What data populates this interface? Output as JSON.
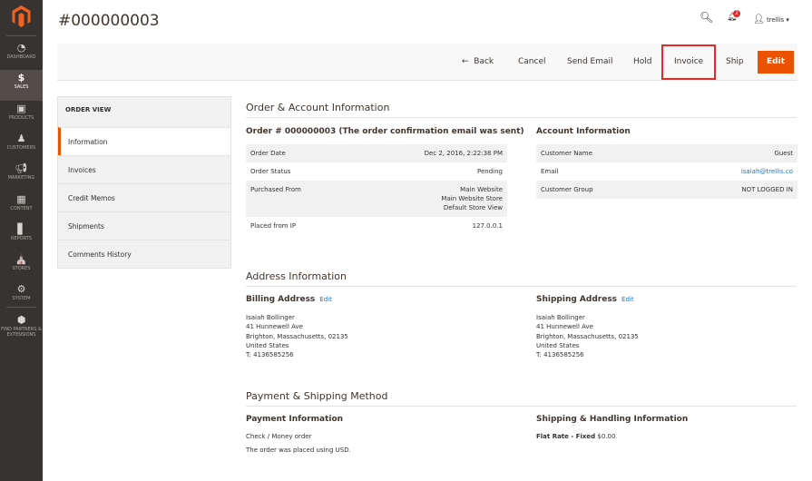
{
  "sidebar": {
    "items": [
      {
        "label": "DASHBOARD",
        "icon": "dashboard-icon"
      },
      {
        "label": "SALES",
        "icon": "dollar-icon",
        "active": true
      },
      {
        "label": "PRODUCTS",
        "icon": "box-icon"
      },
      {
        "label": "CUSTOMERS",
        "icon": "person-icon"
      },
      {
        "label": "MARKETING",
        "icon": "megaphone-icon"
      },
      {
        "label": "CONTENT",
        "icon": "layout-icon"
      },
      {
        "label": "REPORTS",
        "icon": "bar-chart-icon"
      },
      {
        "label": "STORES",
        "icon": "store-icon"
      },
      {
        "label": "SYSTEM",
        "icon": "gear-icon"
      },
      {
        "label": "FIND PARTNERS & EXTENSIONS",
        "icon": "cube-icon"
      }
    ]
  },
  "header": {
    "title": "#000000003",
    "notifications": "2",
    "user": "trellis"
  },
  "actions": {
    "back": "Back",
    "cancel": "Cancel",
    "send_email": "Send Email",
    "hold": "Hold",
    "invoice": "Invoice",
    "ship": "Ship",
    "edit": "Edit"
  },
  "nav": {
    "title": "ORDER VIEW",
    "items": [
      "Information",
      "Invoices",
      "Credit Memos",
      "Shipments",
      "Comments History"
    ]
  },
  "order": {
    "section": "Order & Account Information",
    "title": "Order # 000000003 (The order confirmation email was sent)",
    "rows": [
      {
        "label": "Order Date",
        "value": "Dec 2, 2016, 2:22:38 PM"
      },
      {
        "label": "Order Status",
        "value": "Pending"
      },
      {
        "label": "Purchased From",
        "value": "Main Website\nMain Website Store\nDefault Store View"
      },
      {
        "label": "Placed from IP",
        "value": "127.0.0.1"
      }
    ]
  },
  "account": {
    "title": "Account Information",
    "rows": [
      {
        "label": "Customer Name",
        "value": "Guest"
      },
      {
        "label": "Email",
        "value": "isaiah@trellis.co"
      },
      {
        "label": "Customer Group",
        "value": "NOT LOGGED IN"
      }
    ]
  },
  "address": {
    "section": "Address Information",
    "edit": "Edit",
    "billing": {
      "title": "Billing Address",
      "lines": [
        "Isaiah Bollinger",
        "41 Hunnewell Ave",
        "Brighton, Massachusetts, 02135",
        "United States",
        "T: 4136585256"
      ]
    },
    "shipping": {
      "title": "Shipping Address",
      "lines": [
        "Isaiah Bollinger",
        "41 Hunnewell Ave",
        "Brighton, Massachusetts, 02135",
        "United States",
        "T: 4136585256"
      ]
    }
  },
  "payment": {
    "section": "Payment & Shipping Method",
    "title": "Payment Information",
    "method": "Check / Money order",
    "note": "The order was placed using USD.",
    "ship_title": "Shipping & Handling Information",
    "ship_method": "Flat Rate - Fixed",
    "ship_price": "$0.00"
  },
  "colors": {
    "accent": "#eb5202",
    "sidebar": "#373330",
    "highlight": "#e02b27",
    "link": "#1979c3"
  }
}
